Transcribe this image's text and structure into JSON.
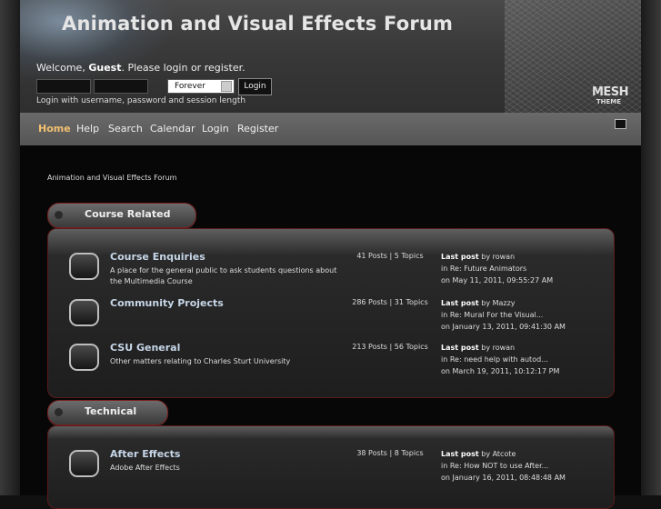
{
  "header": {
    "title": "Animation and Visual Effects Forum",
    "welcome_prefix": "Welcome,",
    "welcome_user": "Guest",
    "welcome_suffix": ". Please login or register.",
    "session_length": "Forever",
    "login_button": "Login",
    "login_hint": "Login with username, password and session length",
    "theme_logo": "MESH",
    "theme_sub": "THEME"
  },
  "nav": {
    "items": [
      "Home",
      "Help",
      "Search",
      "Calendar",
      "Login",
      "Register"
    ]
  },
  "breadcrumb": "Animation and Visual Effects Forum",
  "categories": [
    {
      "name": "Course Related",
      "boards": [
        {
          "name": "Course Enquiries",
          "description": "A place for the general public to ask students questions about the Multimedia Course",
          "stats": "41 Posts | 5 Topics",
          "last_post_label": "Last post",
          "last_post_by": "by rowan",
          "last_post_in": "in Re: Future Animators",
          "last_post_on": "on May 11, 2011, 09:55:27 AM"
        },
        {
          "name": "Community Projects",
          "description": "",
          "stats": "286 Posts | 31 Topics",
          "last_post_label": "Last post",
          "last_post_by": "by Mazzy",
          "last_post_in": "in Re: Mural For the Visual...",
          "last_post_on": "on January 13, 2011, 09:41:30 AM"
        },
        {
          "name": "CSU General",
          "description": "Other matters relating to Charles Sturt University",
          "stats": "213 Posts | 56 Topics",
          "last_post_label": "Last post",
          "last_post_by": "by rowan",
          "last_post_in": "in Re: need help with autod...",
          "last_post_on": "on March 19, 2011, 10:12:17 PM"
        }
      ]
    },
    {
      "name": "Technical",
      "boards": [
        {
          "name": "After Effects",
          "description": "Adobe After Effects",
          "stats": "38 Posts | 8 Topics",
          "last_post_label": "Last post",
          "last_post_by": "by Atcote",
          "last_post_in": "in Re: How NOT to use After...",
          "last_post_on": "on January 16, 2011, 08:48:48 AM"
        }
      ]
    }
  ]
}
